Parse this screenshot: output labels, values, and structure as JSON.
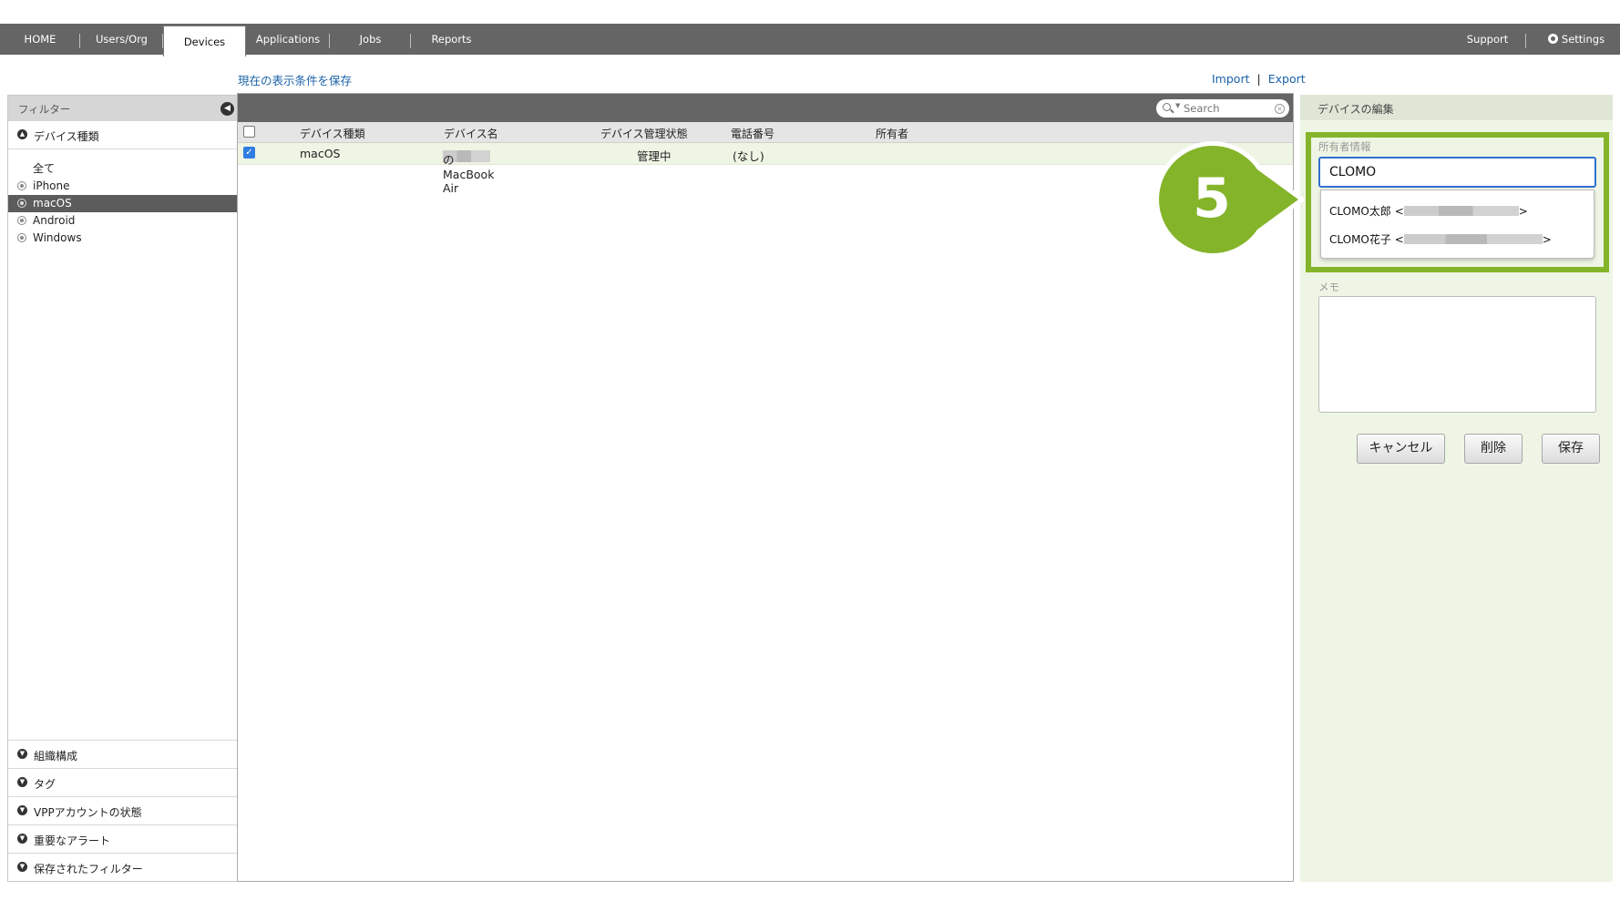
{
  "nav": {
    "tabs": [
      "HOME",
      "Users/Org",
      "Devices",
      "Applications",
      "Jobs",
      "Reports"
    ],
    "support": "Support",
    "settings": "Settings"
  },
  "links": {
    "save_view": "現在の表示条件を保存",
    "import": "Import",
    "separator": "|",
    "export": "Export"
  },
  "filter": {
    "title": "フィルター",
    "device_type_section": "デバイス種類",
    "items": [
      "全て",
      "iPhone",
      "macOS",
      "Android",
      "Windows"
    ],
    "selected": "macOS",
    "bottom_sections": [
      "組織構成",
      "タグ",
      "VPPアカウントの状態",
      "重要なアラート",
      "保存されたフィルター"
    ]
  },
  "table": {
    "search_placeholder": "Search",
    "columns": [
      "デバイス種類",
      "デバイス名",
      "デバイス管理状態",
      "電話番号",
      "所有者"
    ],
    "rows": [
      {
        "checked": true,
        "type": "macOS",
        "name_suffix": "のMacBook Air",
        "status": "管理中",
        "phone": "(なし)",
        "owner": ""
      }
    ]
  },
  "edit": {
    "title": "デバイスの編集",
    "owner_label": "所有者情報",
    "owner_value": "CLOMO",
    "suggestions": [
      {
        "name": "CLOMO太郎",
        "open": "<",
        "close": ">"
      },
      {
        "name": "CLOMO花子",
        "open": "<",
        "close": ">"
      }
    ],
    "memo_label": "メモ",
    "cancel": "キャンセル",
    "delete": "削除",
    "save": "保存"
  },
  "callout": {
    "step": "5",
    "color": "#84b42a"
  },
  "colors": {
    "nav_bg": "#656565",
    "link": "#1a62a8",
    "accent_green": "#84b42a",
    "panel_green": "#eef5e4"
  }
}
